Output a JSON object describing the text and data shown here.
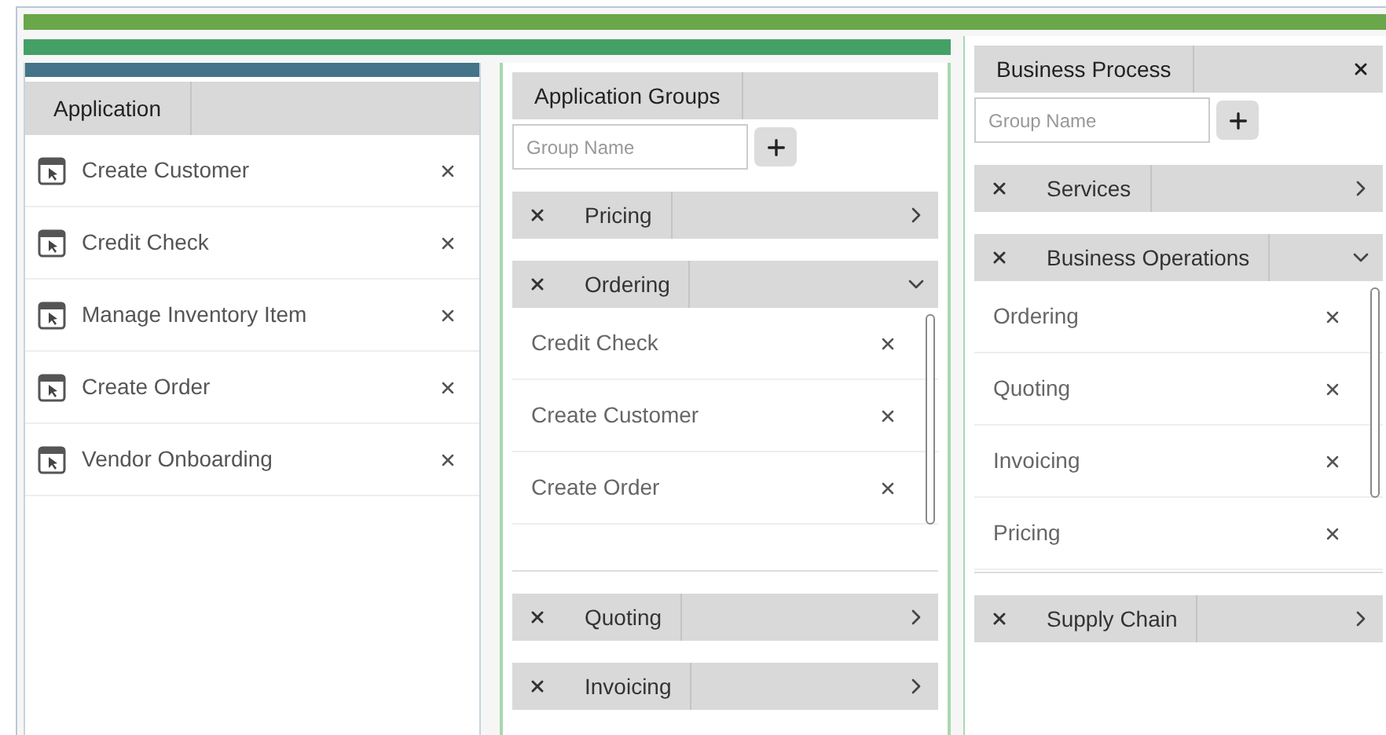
{
  "application_panel": {
    "header": "Application",
    "items": [
      {
        "name": "Create Customer"
      },
      {
        "name": "Credit Check"
      },
      {
        "name": "Manage Inventory Item"
      },
      {
        "name": "Create Order"
      },
      {
        "name": "Vendor Onboarding"
      }
    ]
  },
  "application_groups": {
    "header": "Application Groups",
    "input": {
      "placeholder": "Group Name"
    },
    "groups": [
      {
        "name": "Pricing",
        "expanded": false
      },
      {
        "name": "Ordering",
        "expanded": true,
        "children": [
          {
            "name": "Credit Check"
          },
          {
            "name": "Create Customer"
          },
          {
            "name": "Create Order"
          }
        ]
      },
      {
        "name": "Quoting",
        "expanded": false
      },
      {
        "name": "Invoicing",
        "expanded": false
      }
    ]
  },
  "business_process": {
    "header": "Business Process",
    "input": {
      "placeholder": "Group Name"
    },
    "groups": [
      {
        "name": "Services",
        "expanded": false
      },
      {
        "name": "Business Operations",
        "expanded": true,
        "children": [
          {
            "name": "Ordering"
          },
          {
            "name": "Quoting"
          },
          {
            "name": "Invoicing"
          },
          {
            "name": "Pricing"
          }
        ]
      },
      {
        "name": "Supply Chain",
        "expanded": false
      }
    ]
  }
}
